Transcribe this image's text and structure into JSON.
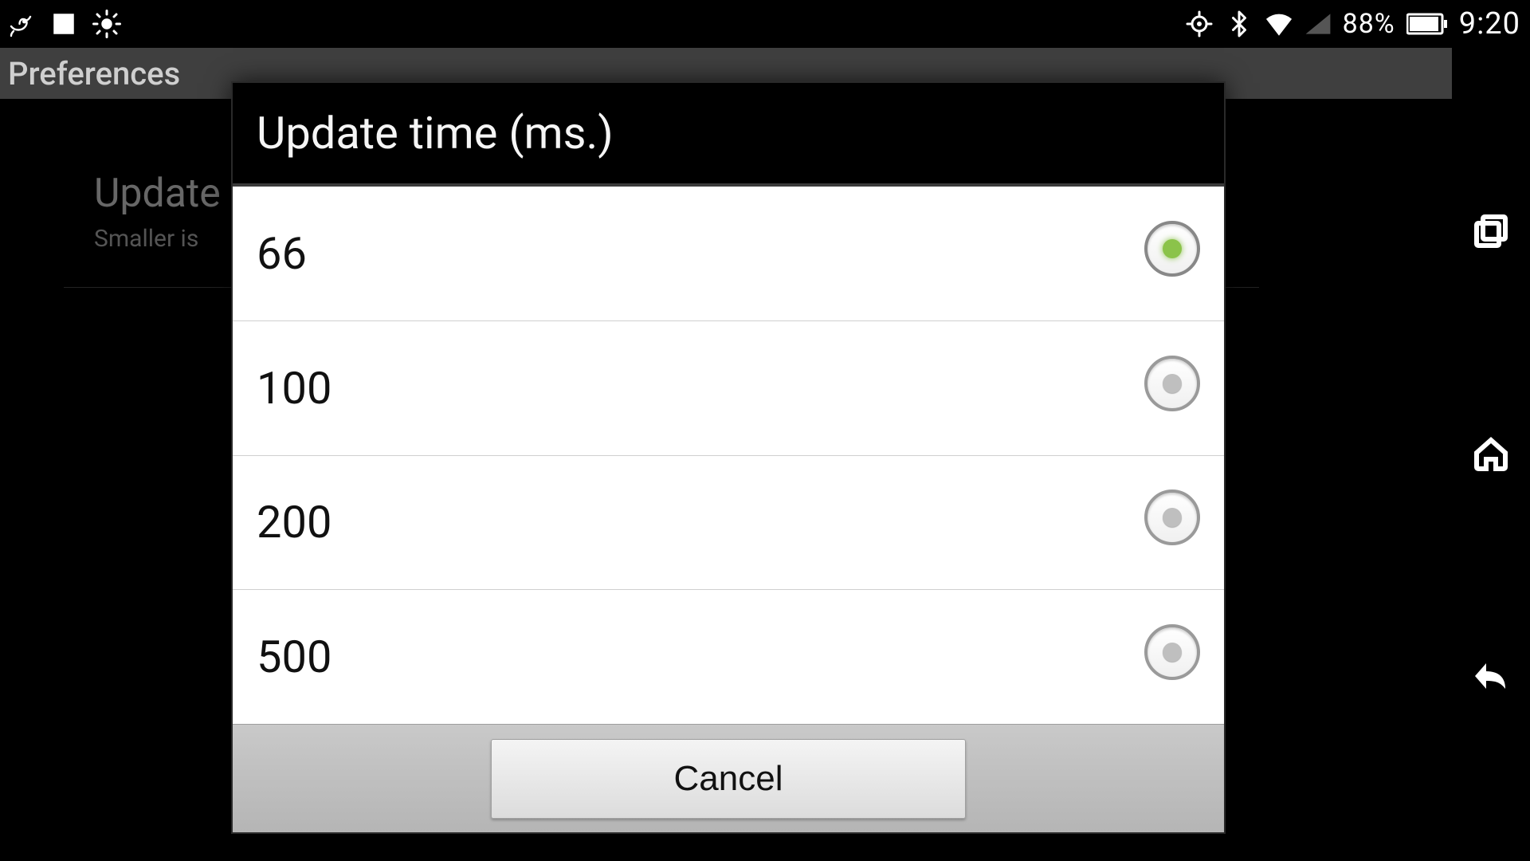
{
  "status_bar": {
    "battery_pct": "88%",
    "clock": "9:20",
    "icons": {
      "chameleon": "chameleon-icon",
      "stop_square": "stop-square-icon",
      "brightness": "brightness-icon",
      "location": "location-crosshair-icon",
      "bluetooth": "bluetooth-icon",
      "wifi": "wifi-icon",
      "cell": "cell-signal-icon",
      "battery": "battery-icon"
    }
  },
  "app_header": {
    "title": "Preferences"
  },
  "background_pref": {
    "title": "Update",
    "subtitle": "Smaller is"
  },
  "navbar": {
    "recent": "recent-apps-icon",
    "home": "home-icon",
    "back": "back-icon"
  },
  "dialog": {
    "title": "Update time (ms.)",
    "options": [
      {
        "label": "66",
        "selected": true
      },
      {
        "label": "100",
        "selected": false
      },
      {
        "label": "200",
        "selected": false
      },
      {
        "label": "500",
        "selected": false
      }
    ],
    "cancel_label": "Cancel"
  }
}
